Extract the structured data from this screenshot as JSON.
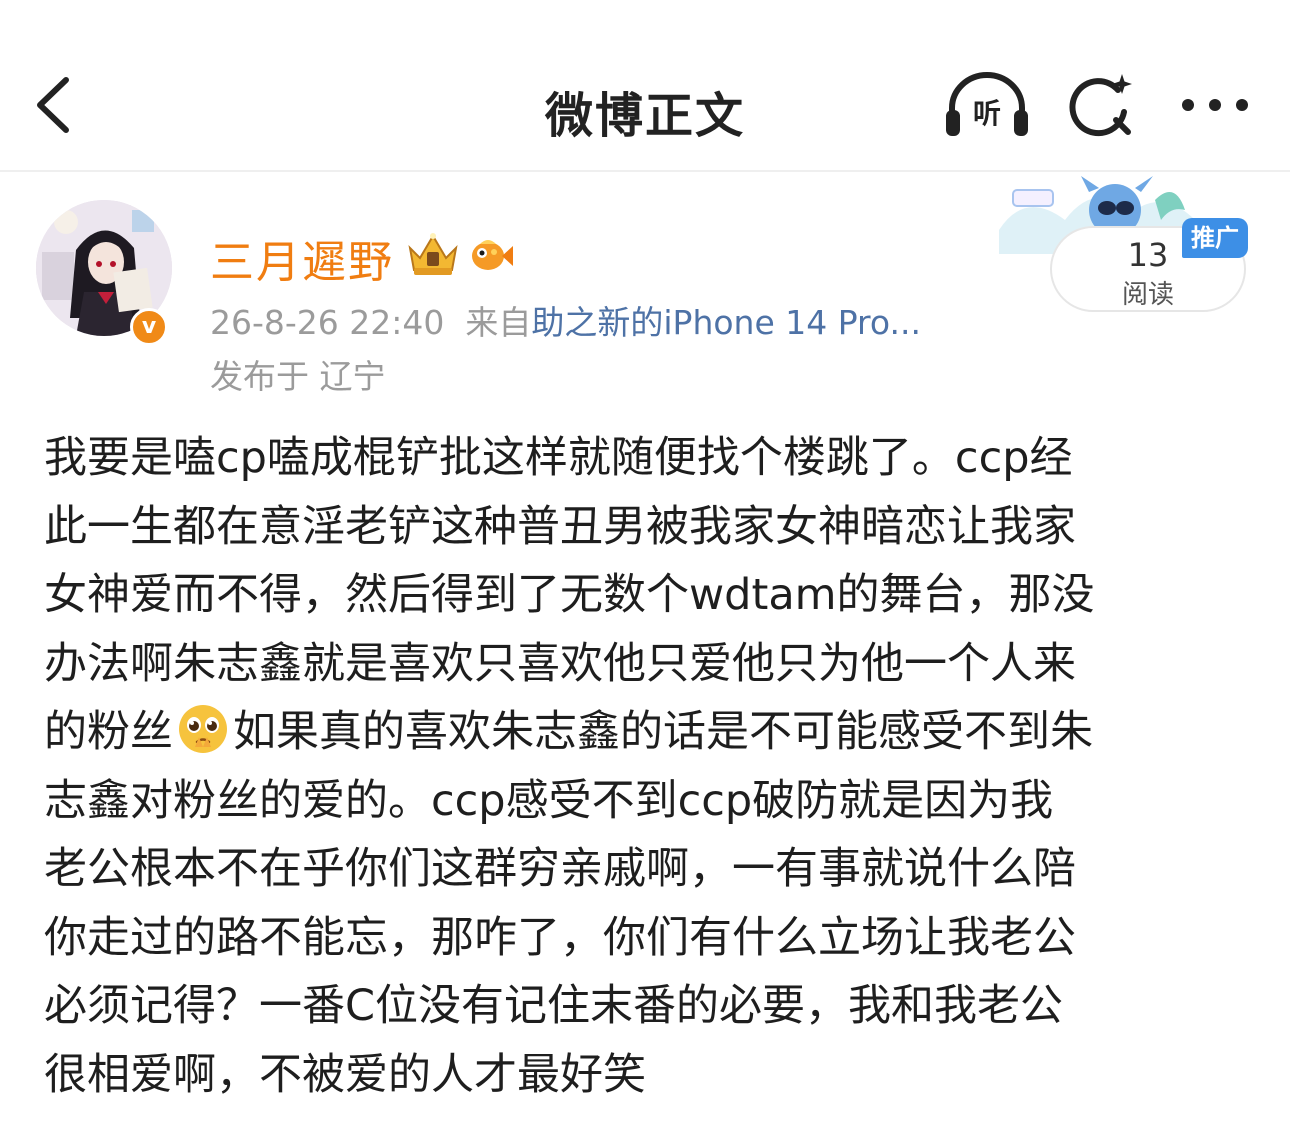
{
  "nav": {
    "title": "微博正文",
    "listen_label": "听",
    "back_icon": "chevron-left-icon",
    "search_icon": "search-sparkle-icon",
    "more_icon": "more-dots-icon"
  },
  "author": {
    "name": "三月遲野",
    "verified_icon": "verified-v-icon",
    "badges": [
      "crown-badge-icon",
      "fish-badge-icon"
    ],
    "name_color": "#f07d11"
  },
  "post_meta": {
    "time": "26-8-26 22:40",
    "source_prefix": "来自",
    "device": "助之新的iPhone 14 Pro...",
    "location": "发布于 辽宁"
  },
  "promo": {
    "read_count": "13",
    "read_label": "阅读",
    "tag": "推广",
    "tag_color": "#3d8fe6"
  },
  "content": {
    "lines": [
      "我要是嗑cp嗑成棍铲批这样就随便找个楼跳了。ccp经",
      "此一生都在意淫老铲这种普丑男被我家女神暗恋让我家",
      "女神爱而不得，然后得到了无数个wdtam的舞台，那没",
      "办法啊朱志鑫就是喜欢只喜欢他只爱他只为他一个人来",
      "的粉丝",
      "如果真的喜欢朱志鑫的话是不可能感受不到朱",
      "志鑫对粉丝的爱的。ccp感受不到ccp破防就是因为我",
      "老公根本不在乎你们这群穷亲戚啊，一有事就说什么陪",
      "你走过的路不能忘，那咋了，你们有什么立场让我老公",
      "必须记得？一番C位没有记住末番的必要，我和我老公",
      "很相爱啊，不被爱的人才最好笑"
    ],
    "emoji": "pleading-face-emoji"
  }
}
